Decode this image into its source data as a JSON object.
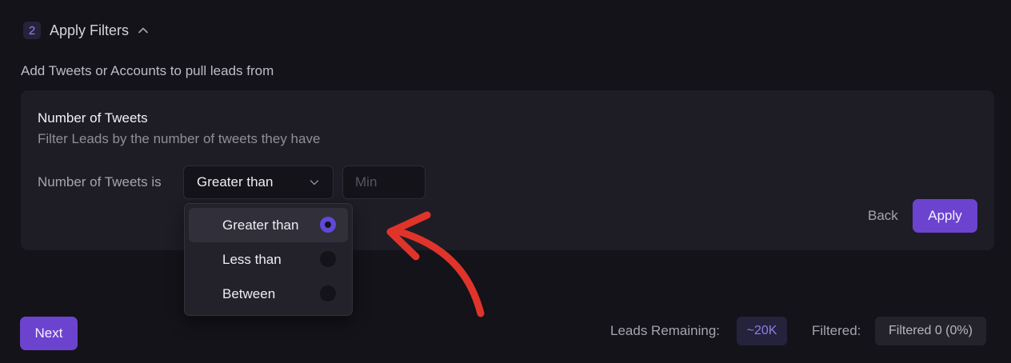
{
  "step": {
    "number": "2",
    "title": "Apply Filters",
    "chevron_icon": "chevron-up-icon"
  },
  "subtitle": "Add Tweets or Accounts to pull leads from",
  "filter_card": {
    "title": "Number of Tweets",
    "description": "Filter Leads by the number of tweets they have",
    "condition_label": "Number of Tweets is",
    "select_value": "Greater than",
    "min_placeholder": "Min",
    "min_value": "",
    "back_label": "Back",
    "apply_label": "Apply"
  },
  "dropdown": {
    "options": [
      {
        "label": "Greater than",
        "selected": true
      },
      {
        "label": "Less than",
        "selected": false
      },
      {
        "label": "Between",
        "selected": false
      }
    ]
  },
  "footer": {
    "next_label": "Next",
    "leads_remaining_label": "Leads Remaining:",
    "leads_remaining_value": "~20K",
    "filtered_label": "Filtered:",
    "filtered_value": "Filtered 0 (0%)"
  },
  "colors": {
    "background": "#141319",
    "card": "#1e1d26",
    "accent": "#6b43cf",
    "annotation_arrow": "#e0342b"
  }
}
